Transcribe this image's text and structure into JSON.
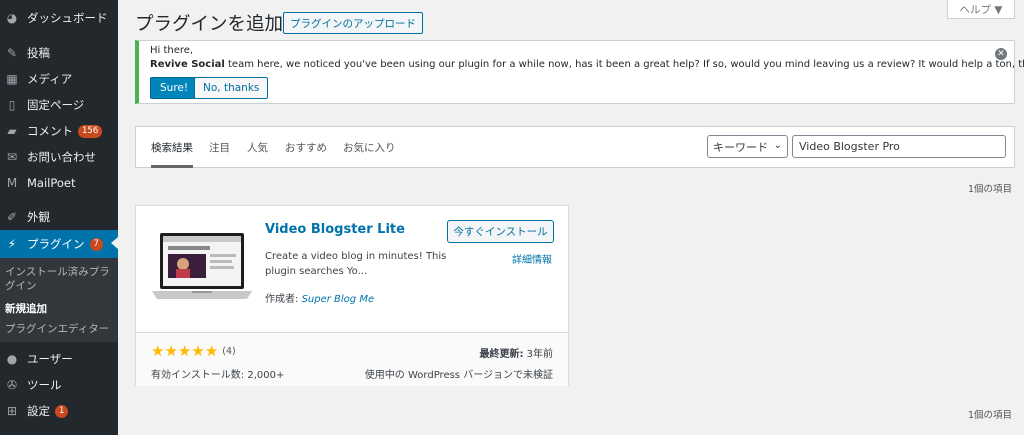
{
  "sidebar": {
    "items": [
      {
        "label": "ダッシュボード",
        "icon": "dashboard-icon",
        "glyph": "◕"
      },
      {
        "label": "投稿",
        "icon": "pin-icon",
        "glyph": "✎"
      },
      {
        "label": "メディア",
        "icon": "media-icon",
        "glyph": "▦"
      },
      {
        "label": "固定ページ",
        "icon": "page-icon",
        "glyph": "▯"
      },
      {
        "label": "コメント",
        "icon": "comment-icon",
        "glyph": "▰",
        "badge": "156"
      },
      {
        "label": "お問い合わせ",
        "icon": "mail-icon",
        "glyph": "✉"
      },
      {
        "label": "MailPoet",
        "icon": "mailpoet-icon",
        "glyph": "M"
      },
      {
        "label": "外観",
        "icon": "appearance-icon",
        "glyph": "✐"
      },
      {
        "label": "プラグイン",
        "icon": "plugin-icon",
        "glyph": "⚡",
        "badge": "7"
      },
      {
        "label": "ユーザー",
        "icon": "user-icon",
        "glyph": "●"
      },
      {
        "label": "ツール",
        "icon": "tools-icon",
        "glyph": "✇"
      },
      {
        "label": "設定",
        "icon": "settings-icon",
        "glyph": "⊞",
        "badge": "1"
      }
    ],
    "submenu": {
      "installed": "インストール済みプラグイン",
      "add_new": "新規追加",
      "editor": "プラグインエディター"
    }
  },
  "header": {
    "title": "プラグインを追加",
    "upload_label": "プラグインのアップロード",
    "help_label": "ヘルプ ▼"
  },
  "notice": {
    "greeting": "Hi there,",
    "brand": "Revive Social",
    "message": " team here, we noticed you've been using our plugin for a while now, has it been a great help? If so, would you mind leaving us a review? It would help a ton, thanks!",
    "sure_label": "Sure!",
    "no_label": "No, thanks"
  },
  "filter": {
    "tabs": [
      "検索結果",
      "注目",
      "人気",
      "おすすめ",
      "お気に入り"
    ],
    "search_type": "キーワード",
    "search_value": "Video Blogster Pro"
  },
  "results": {
    "count_top": "1個の項目",
    "count_bottom": "1個の項目"
  },
  "plugin": {
    "name": "Video Blogster Lite",
    "install_label": "今すぐインストール",
    "details_label": "詳細情報",
    "description": "Create a video blog in minutes! This plugin searches Yo...",
    "author_prefix": "作成者: ",
    "author": "Super Blog Me",
    "rating": 5,
    "rating_count": "(4)",
    "installs": "有効インストール数: 2,000+",
    "last_updated_label": "最終更新:",
    "last_updated_value": " 3年前",
    "compat": "使用中の WordPress バージョンで未検証"
  },
  "colors": {
    "sidebar_bg": "#23282d",
    "active_blue": "#0073aa",
    "notice_green": "#46b450",
    "star": "#ffb900",
    "badge": "#ca4a1f"
  }
}
